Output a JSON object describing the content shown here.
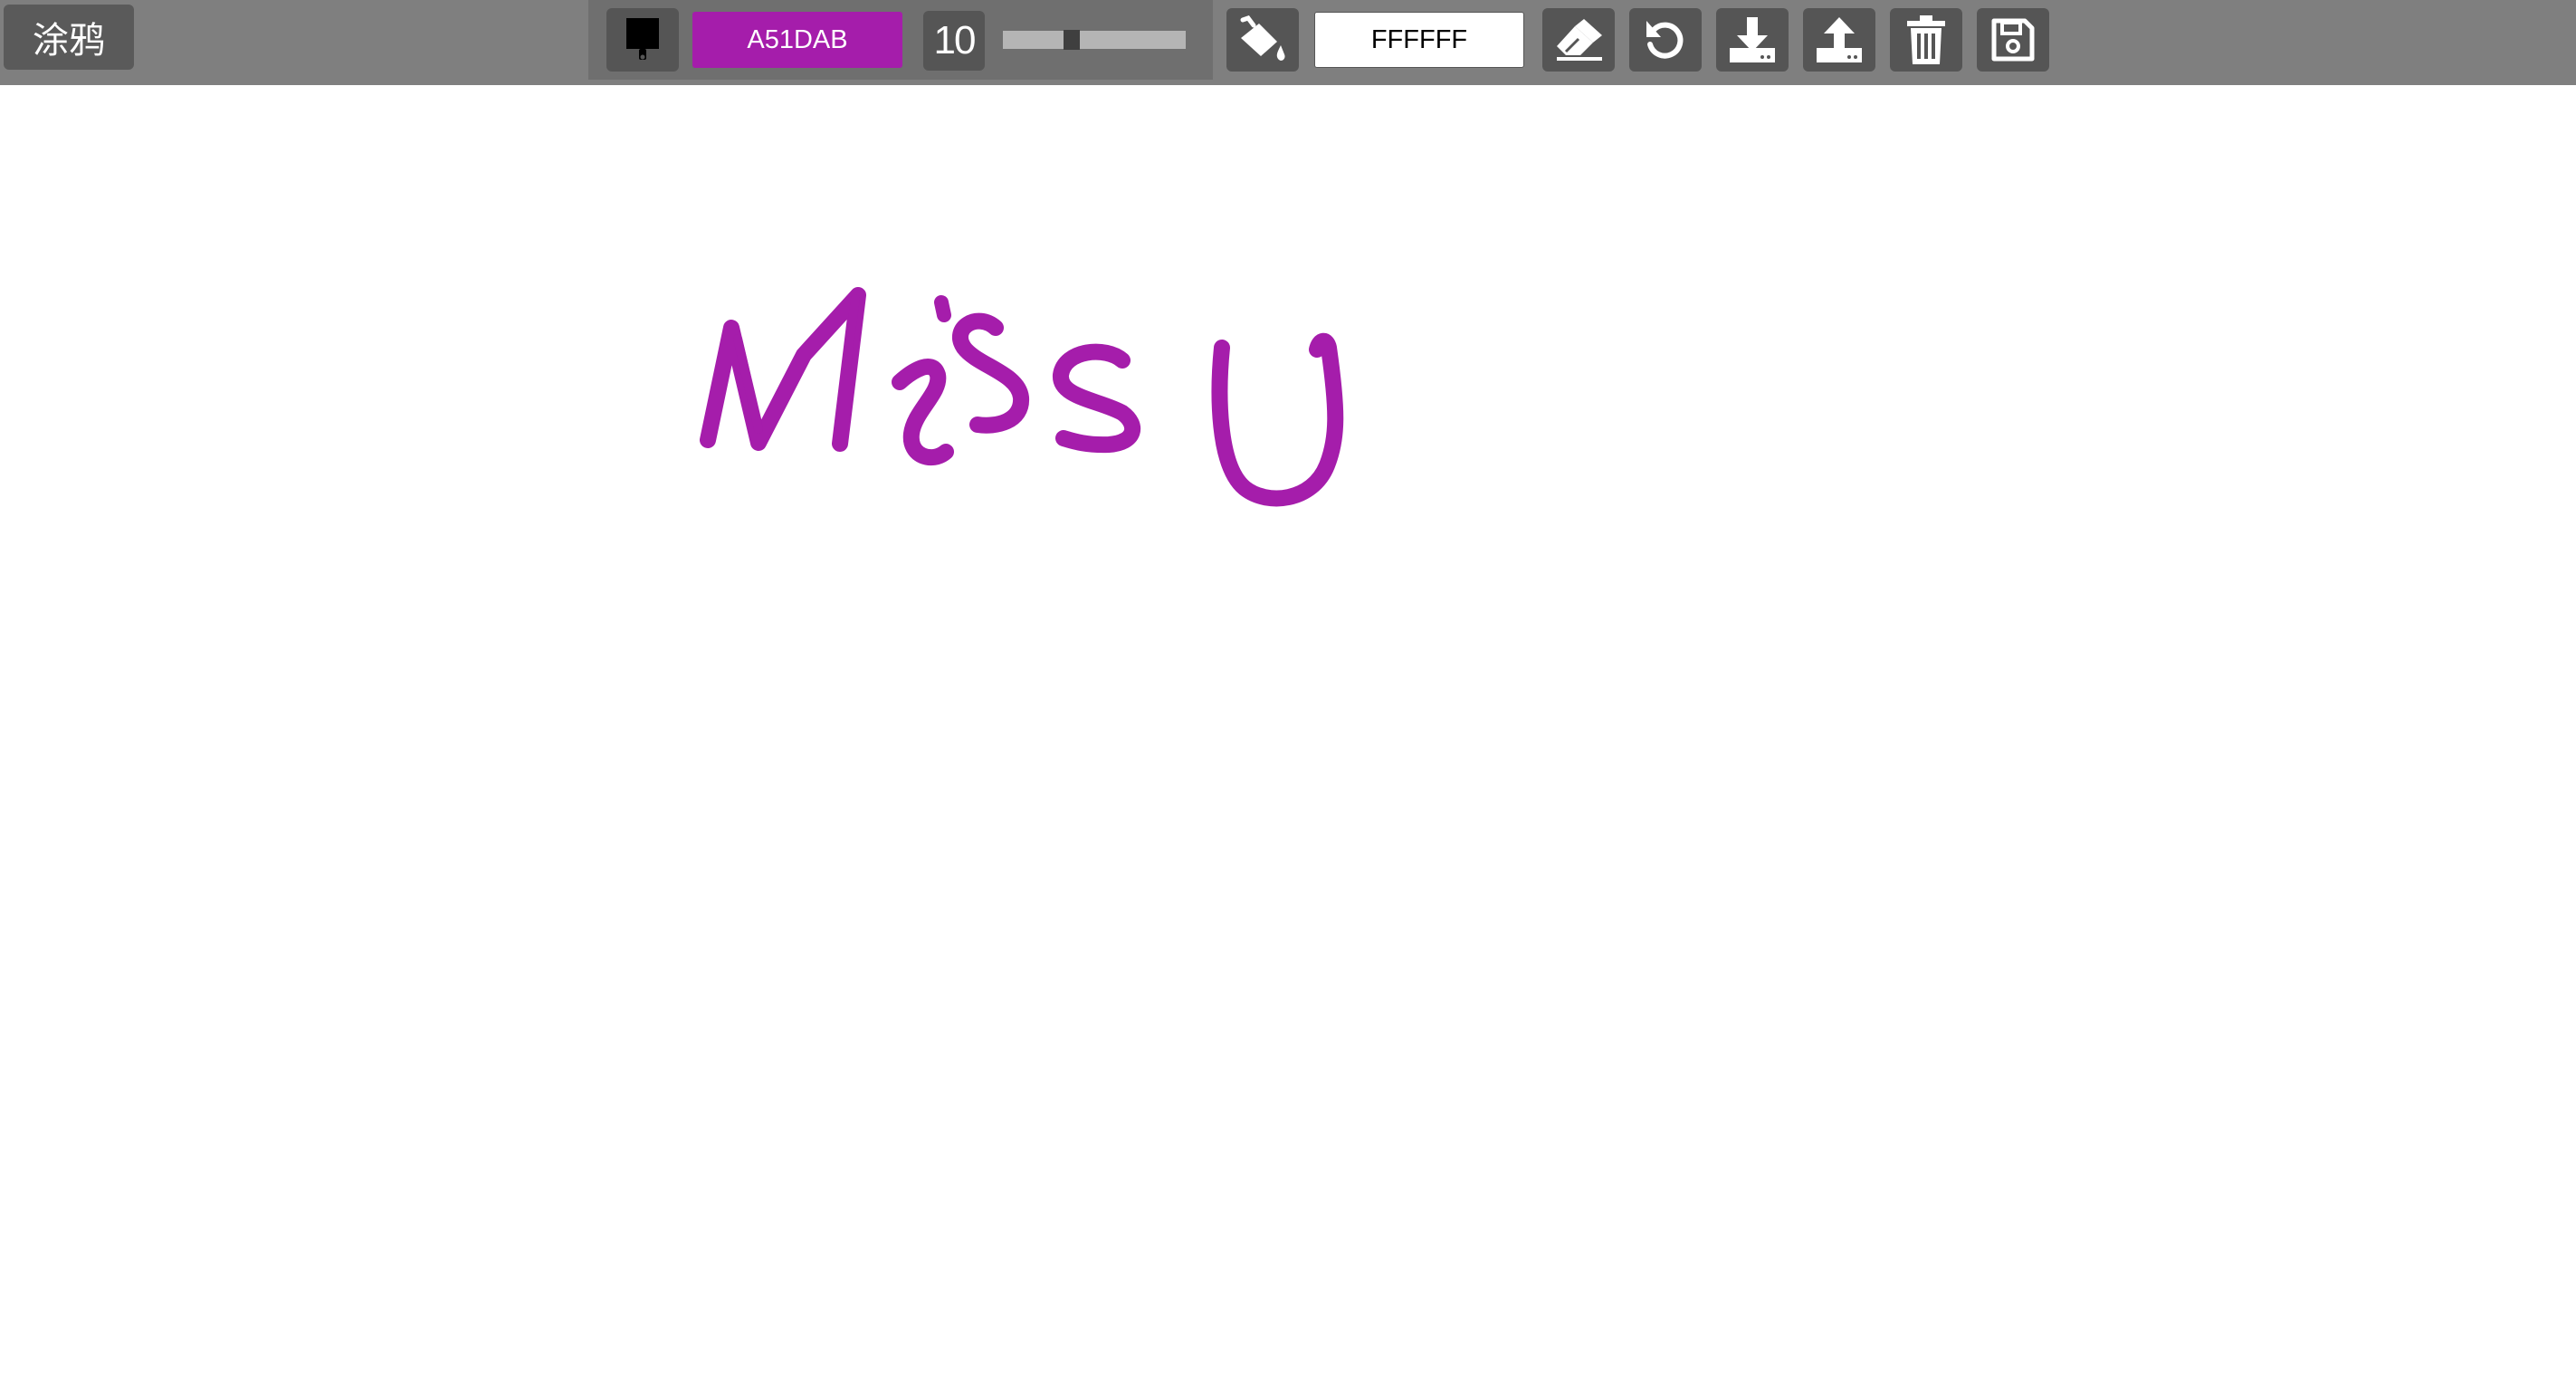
{
  "app": {
    "title": "涂鸦"
  },
  "brush": {
    "tool_icon": "paint-brush-icon",
    "color_hex": "A51DAB",
    "color": "#A51DAB",
    "size": "10",
    "size_fraction": 0.2
  },
  "fill": {
    "tool_icon": "paint-bucket-icon",
    "color_hex": "FFFFFF",
    "color": "#FFFFFF"
  },
  "tools": [
    {
      "name": "eraser",
      "icon": "eraser-icon"
    },
    {
      "name": "undo",
      "icon": "undo-icon"
    },
    {
      "name": "download",
      "icon": "download-icon"
    },
    {
      "name": "upload",
      "icon": "upload-icon"
    },
    {
      "name": "clear",
      "icon": "trash-icon"
    },
    {
      "name": "save",
      "icon": "save-icon"
    }
  ],
  "canvas": {
    "background": "#FFFFFF",
    "stroke_color": "#A51DAB",
    "drawing_text": "Miss U"
  }
}
